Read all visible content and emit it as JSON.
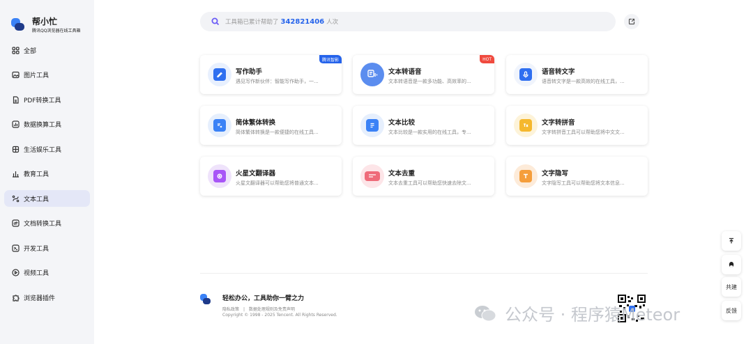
{
  "brand": {
    "title": "帮小忙",
    "subtitle": "腾讯QQ浏览器在线工具箱"
  },
  "sidebar": {
    "items": [
      {
        "label": "全部",
        "icon": "grid-icon"
      },
      {
        "label": "图片工具",
        "icon": "image-icon"
      },
      {
        "label": "PDF转换工具",
        "icon": "pdf-icon"
      },
      {
        "label": "数据换算工具",
        "icon": "chart-icon"
      },
      {
        "label": "生活娱乐工具",
        "icon": "life-icon"
      },
      {
        "label": "教育工具",
        "icon": "education-icon"
      },
      {
        "label": "文本工具",
        "icon": "text-icon",
        "active": true
      },
      {
        "label": "文档转换工具",
        "icon": "document-convert-icon"
      },
      {
        "label": "开发工具",
        "icon": "code-icon"
      },
      {
        "label": "视频工具",
        "icon": "video-icon"
      },
      {
        "label": "浏览器插件",
        "icon": "plugin-icon"
      }
    ]
  },
  "search": {
    "prefix": "工具箱已累计帮助了",
    "count": "342821406",
    "suffix": "人次"
  },
  "tools": [
    {
      "title": "写作助手",
      "desc": "遇见写作新伙伴：智能写作助手，一...",
      "badge": "腾讯智影",
      "badge_color": "#2563eb",
      "icon": "writing-assistant-icon",
      "color": "#2f6ff0",
      "bg": "#e8f0fe"
    },
    {
      "title": "文本转语音",
      "desc": "文本转语音是一款多功能、高效率的...",
      "badge": "HOT",
      "badge_color": "#f04a3e",
      "icon": "text-to-speech-icon",
      "color": "#5b8def",
      "bg": "#e3ecfd"
    },
    {
      "title": "语音转文字",
      "desc": "语音转文字是一款高效的在线工具，...",
      "badge": "",
      "icon": "speech-to-text-icon",
      "color": "#2f6ff0",
      "bg": "#f0f4fc"
    },
    {
      "title": "简体繁体转换",
      "desc": "简体繁体转换是一款便捷的在线工具...",
      "badge": "",
      "icon": "simplified-traditional-icon",
      "color": "#3b82f6",
      "bg": "#e6effd"
    },
    {
      "title": "文本比较",
      "desc": "文本比较是一款实用的在线工具，专...",
      "badge": "",
      "icon": "text-compare-icon",
      "color": "#3b82f6",
      "bg": "#e6effd"
    },
    {
      "title": "文字转拼音",
      "desc": "文字转拼音工具可以帮助您将中文文...",
      "badge": "",
      "icon": "text-to-pinyin-icon",
      "color": "#f5b82e",
      "bg": "#fdf3d9"
    },
    {
      "title": "火星文翻译器",
      "desc": "火星文翻译器可以帮助您将普通文本...",
      "badge": "",
      "icon": "martian-translator-icon",
      "color": "#a855f7",
      "bg": "#efe3fb"
    },
    {
      "title": "文本去重",
      "desc": "文本去重工具可以帮助您快速去除文...",
      "badge": "",
      "icon": "text-dedupe-icon",
      "color": "#ef6b7a",
      "bg": "#fde5e8"
    },
    {
      "title": "文字隐写",
      "desc": "文字隐写工具可以帮助您将文本信息...",
      "badge": "",
      "icon": "text-steganography-icon",
      "color": "#f59e3b",
      "bg": "#fdebd9"
    }
  ],
  "footer": {
    "slogan": "轻松办公，工具助你一臂之力",
    "links": [
      "隐私政策",
      "|",
      "数据处理规则及免责声明"
    ],
    "copyright": "Copyright © 1998 - 2025 Tencent. All Rights Reserved."
  },
  "watermark": {
    "text": "公众号 · 程序猿Meteor"
  },
  "float_buttons": [
    {
      "label": "",
      "icon": "back-to-top-icon"
    },
    {
      "label": "",
      "icon": "qq-penguin-icon"
    },
    {
      "label": "共建"
    },
    {
      "label": "反馈"
    }
  ]
}
